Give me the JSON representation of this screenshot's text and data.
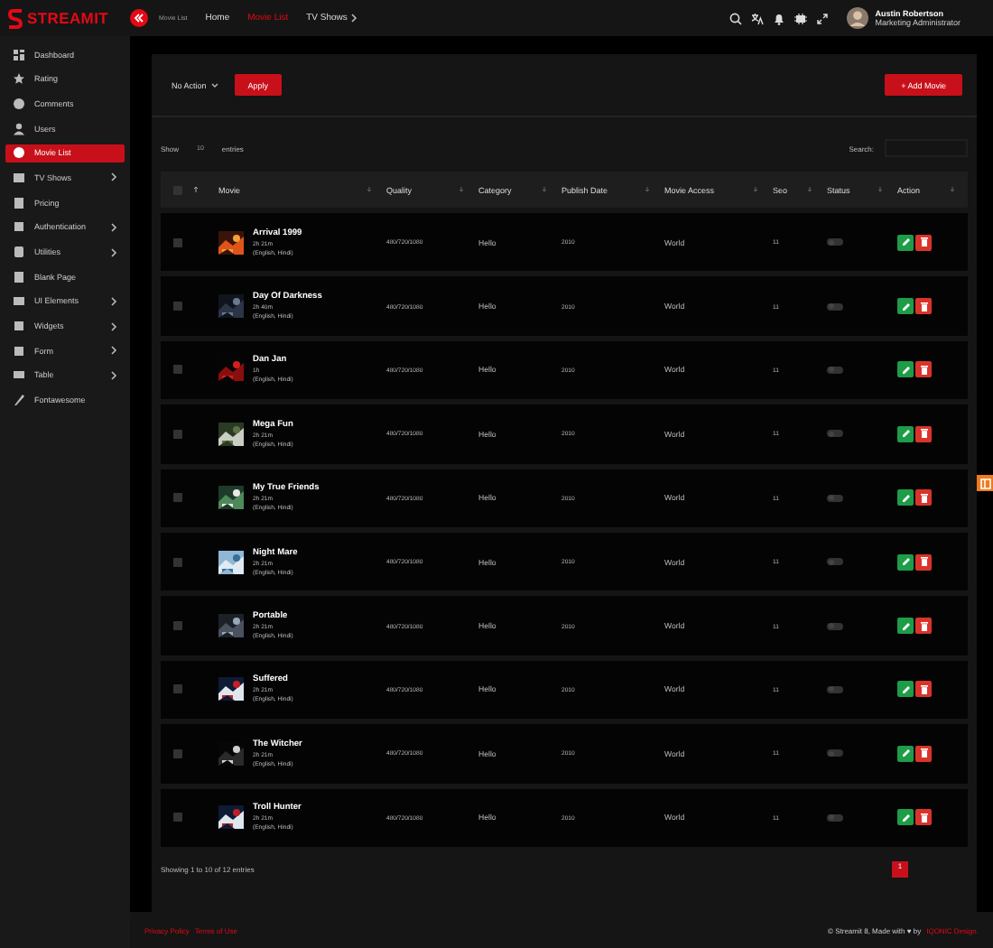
{
  "header": {
    "logo": "STREAMIT",
    "breadcrumb": [
      {
        "label": "Movie List",
        "selected": false
      },
      {
        "label": "Home",
        "selected": false
      },
      {
        "label": "Movie List",
        "selected": true
      },
      {
        "label": "TV Shows",
        "selected": false,
        "has_arrow": true
      }
    ],
    "user": {
      "name": "Austin Robertson",
      "role": "Marketing Administrator"
    }
  },
  "sidebar": {
    "items": [
      {
        "label": "Dashboard",
        "selected": false,
        "has_arrow": false
      },
      {
        "label": "Rating",
        "selected": false,
        "has_arrow": false
      },
      {
        "label": "Comments",
        "selected": false,
        "has_arrow": false
      },
      {
        "label": "Users",
        "selected": false,
        "has_arrow": false
      },
      {
        "label": "Movie List",
        "selected": true,
        "has_arrow": false
      },
      {
        "label": "TV Shows",
        "selected": false,
        "has_arrow": true
      },
      {
        "label": "Pricing",
        "selected": false,
        "has_arrow": false
      },
      {
        "label": "Authentication",
        "selected": false,
        "has_arrow": true
      },
      {
        "label": "Utilities",
        "selected": false,
        "has_arrow": true
      },
      {
        "label": "Blank Page",
        "selected": false,
        "has_arrow": false
      },
      {
        "label": "UI Elements",
        "selected": false,
        "has_arrow": true
      },
      {
        "label": "Widgets",
        "selected": false,
        "has_arrow": true
      },
      {
        "label": "Form",
        "selected": false,
        "has_arrow": true
      },
      {
        "label": "Table",
        "selected": false,
        "has_arrow": true
      },
      {
        "label": "Fontawesome",
        "selected": false,
        "has_arrow": false
      }
    ]
  },
  "toolbar": {
    "bulk_action": "No Action",
    "apply": "Apply",
    "add": "Add Movie",
    "add_icon": "+"
  },
  "table_controls": {
    "show": "Show",
    "page_size": "10",
    "entries": "entries",
    "search_label": "Search:"
  },
  "table": {
    "select_all_checked": false,
    "columns": [
      "Movie",
      "Quality",
      "Category",
      "Publish Date",
      "Movie Access",
      "Seo",
      "Status",
      "Action"
    ],
    "rows": [
      {
        "checked": false,
        "title": "Arrival 1999",
        "duration": "2h 21m",
        "languages": "(English, Hindi)",
        "quality": "480/720/1080",
        "category": "Hello",
        "publish_date": "2010",
        "access": "World",
        "seo": "11",
        "status_on": false
      },
      {
        "checked": false,
        "title": "Day Of Darkness",
        "duration": "2h 40m",
        "languages": "(English, Hindi)",
        "quality": "480/720/1080",
        "category": "Hello",
        "publish_date": "2010",
        "access": "World",
        "seo": "11",
        "status_on": false
      },
      {
        "checked": false,
        "title": "Dan Jan",
        "duration": "1h",
        "languages": "(English, Hindi)",
        "quality": "480/720/1080",
        "category": "Hello",
        "publish_date": "2010",
        "access": "World",
        "seo": "11",
        "status_on": false
      },
      {
        "checked": false,
        "title": "Mega Fun",
        "duration": "2h 21m",
        "languages": "(English, Hindi)",
        "quality": "480/720/1080",
        "category": "Hello",
        "publish_date": "2010",
        "access": "World",
        "seo": "11",
        "status_on": false
      },
      {
        "checked": false,
        "title": "My True Friends",
        "duration": "2h 21m",
        "languages": "(English, Hindi)",
        "quality": "480/720/1080",
        "category": "Hello",
        "publish_date": "2010",
        "access": "World",
        "seo": "11",
        "status_on": false
      },
      {
        "checked": false,
        "title": "Night Mare",
        "duration": "2h 21m",
        "languages": "(English, Hindi)",
        "quality": "480/720/1080",
        "category": "Hello",
        "publish_date": "2010",
        "access": "World",
        "seo": "11",
        "status_on": false
      },
      {
        "checked": false,
        "title": "Portable",
        "duration": "2h 21m",
        "languages": "(English, Hindi)",
        "quality": "480/720/1080",
        "category": "Hello",
        "publish_date": "2010",
        "access": "World",
        "seo": "11",
        "status_on": false
      },
      {
        "checked": false,
        "title": "Suffered",
        "duration": "2h 21m",
        "languages": "(English, Hindi)",
        "quality": "480/720/1080",
        "category": "Hello",
        "publish_date": "2010",
        "access": "World",
        "seo": "11",
        "status_on": false
      },
      {
        "checked": false,
        "title": "The Witcher",
        "duration": "2h 21m",
        "languages": "(English, Hindi)",
        "quality": "480/720/1080",
        "category": "Hello",
        "publish_date": "2010",
        "access": "World",
        "seo": "11",
        "status_on": false
      },
      {
        "checked": false,
        "title": "Troll Hunter",
        "duration": "2h 21m",
        "languages": "(English, Hindi)",
        "quality": "480/720/1080",
        "category": "Hello",
        "publish_date": "2010",
        "access": "World",
        "seo": "11",
        "status_on": false
      }
    ]
  },
  "table_footer": {
    "info": "Showing 1 to 10 of 12 entries",
    "pages": [
      {
        "label": "1",
        "selected": true
      }
    ]
  },
  "footer": {
    "links": [
      "Privacy Policy",
      "Terms of Use"
    ],
    "copyright": "© Streamit 8, Made with ♥ by",
    "credit": "IQONIC Design."
  }
}
